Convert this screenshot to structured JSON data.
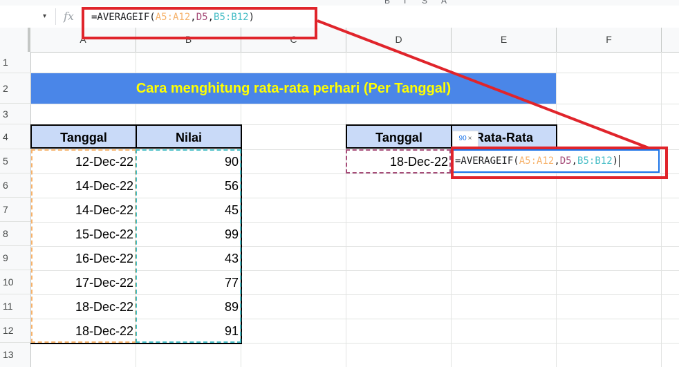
{
  "formula_bar": {
    "fx_icon": "fx",
    "formula_parts": [
      {
        "text": "=AVERAGEIF(",
        "color": "#202124"
      },
      {
        "text": "A5:A12",
        "color": "#f6b26b"
      },
      {
        "text": ",",
        "color": "#202124"
      },
      {
        "text": "D5",
        "color": "#a64d79"
      },
      {
        "text": ",",
        "color": "#202124"
      },
      {
        "text": "B5:B12",
        "color": "#46bdc6"
      },
      {
        "text": ")",
        "color": "#202124"
      }
    ]
  },
  "columns": [
    "A",
    "B",
    "C",
    "D",
    "E",
    "F"
  ],
  "rows": [
    "1",
    "2",
    "3",
    "4",
    "5",
    "6",
    "7",
    "8",
    "9",
    "10",
    "11",
    "12",
    "13"
  ],
  "title": "Cara menghitung rata-rata perhari (Per Tanggal)",
  "table1": {
    "headers": [
      "Tanggal",
      "Nilai"
    ],
    "rows": [
      {
        "date": "12-Dec-22",
        "value": "90"
      },
      {
        "date": "14-Dec-22",
        "value": "56"
      },
      {
        "date": "14-Dec-22",
        "value": "45"
      },
      {
        "date": "15-Dec-22",
        "value": "99"
      },
      {
        "date": "16-Dec-22",
        "value": "43"
      },
      {
        "date": "17-Dec-22",
        "value": "77"
      },
      {
        "date": "18-Dec-22",
        "value": "89"
      },
      {
        "date": "18-Dec-22",
        "value": "91"
      }
    ]
  },
  "table2": {
    "headers": [
      "Tanggal",
      "Rata-Rata"
    ],
    "date": "18-Dec-22"
  },
  "tooltip": {
    "value": "90",
    "close": "×"
  },
  "edit_cell_parts": [
    {
      "text": "=AVERAGEIF",
      "color": "#202124"
    },
    {
      "text": "(",
      "color": "#202124"
    },
    {
      "text": "A5:A12",
      "color": "#f6b26b"
    },
    {
      "text": ",",
      "color": "#202124"
    },
    {
      "text": "D5",
      "color": "#a64d79"
    },
    {
      "text": ",",
      "color": "#202124"
    },
    {
      "text": "B5:B12",
      "color": "#46bdc6"
    },
    {
      "text": ")",
      "color": "#202124"
    }
  ],
  "colors": {
    "title_bg": "#4a86e8",
    "title_fg": "#ffff00",
    "header_bg": "#c9daf8",
    "annotation_red": "#e0242b"
  }
}
